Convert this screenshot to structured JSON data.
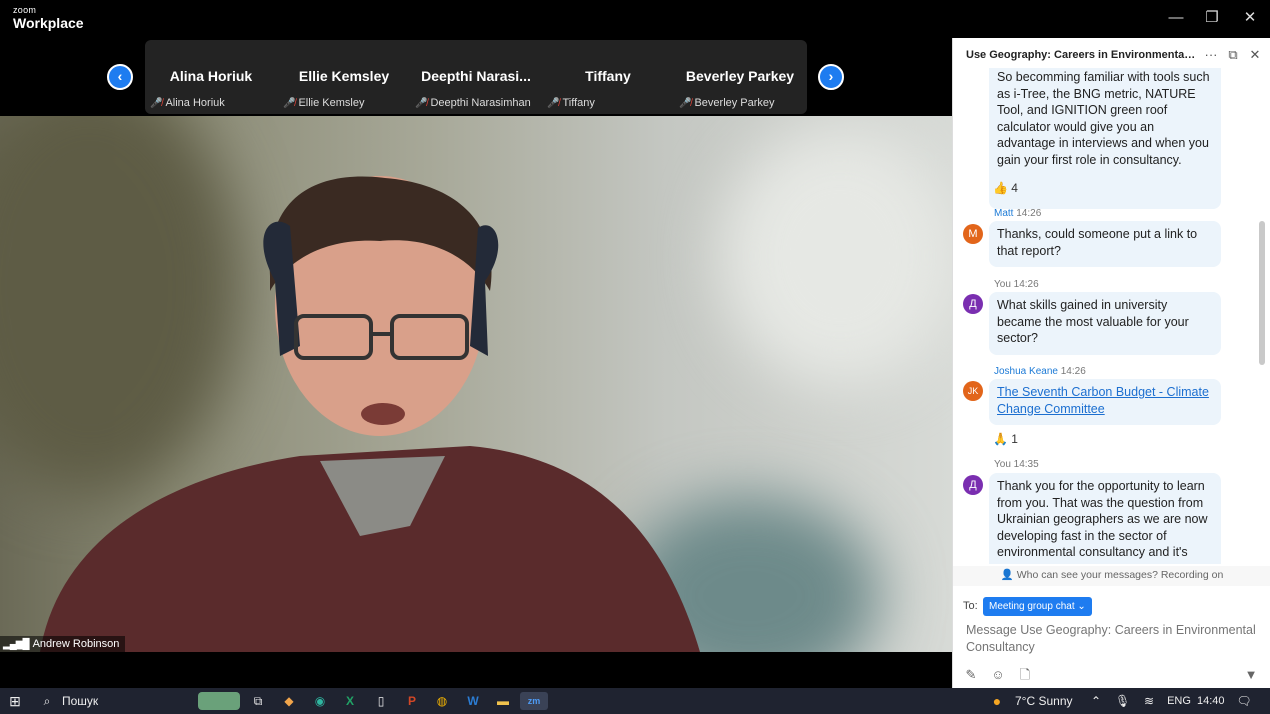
{
  "app": {
    "brand_small": "zoom",
    "brand_big": "Workplace"
  },
  "window_controls": {
    "minimize": "—",
    "restore": "❐",
    "close": "✕"
  },
  "participant_nav": {
    "prev": "‹",
    "next": "›"
  },
  "participants": [
    {
      "tile_name": "Alina Horiuk",
      "label": "Alina Horiuk"
    },
    {
      "tile_name": "Ellie Kemsley",
      "label": "Ellie Kemsley"
    },
    {
      "tile_name": "Deepthi  Narasi...",
      "label": "Deepthi Narasimhan"
    },
    {
      "tile_name": "Tiffany",
      "label": "Tiffany"
    },
    {
      "tile_name": "Beverley Parkey",
      "label": "Beverley Parkey"
    }
  ],
  "speaker": {
    "name": "Andrew Robinson",
    "signal_icon": "signal-bars-icon"
  },
  "chat": {
    "title": "Use Geography: Careers in Environmental C...",
    "header_icons": {
      "more": "···",
      "popout": "⧉",
      "close": "✕"
    },
    "messages": [
      {
        "text": "So becomming familiar with tools such as i-Tree, the BNG metric, NATURE Tool, and IGNITION green roof calculator would give you an advantage in interviews and when you gain your first role in consultancy.",
        "reaction": "👍 4"
      },
      {
        "sender": "Matt",
        "time": "14:26",
        "avatar": "M",
        "avatar_color": "#e2651a",
        "text": "Thanks, could someone put a link to that report?"
      },
      {
        "sender": "You",
        "time": "14:26",
        "avatar": "Д",
        "avatar_color": "#7a2eb0",
        "text": "What skills gained in university became the most valuable for your sector?"
      },
      {
        "sender": "Joshua Keane",
        "time": "14:26",
        "avatar": "JK",
        "avatar_color": "#e2651a",
        "text": "The Seventh Carbon Budget - Climate Change Committee",
        "reaction": "🙏 1"
      },
      {
        "sender": "You",
        "time": "14:35",
        "avatar": "Д",
        "avatar_color": "#7a2eb0",
        "text": "Thank you  for the opportunity to learn from you. That was the question from Ukrainian geographers as we are now  developing fast in the sector of environmental consultancy and it's"
      }
    ],
    "visibility_notice": "Who can see your messages? Recording on",
    "to_label": "To:",
    "recipient": "Meeting group chat",
    "input_placeholder": "Message Use Geography: Careers in Environmental Consultancy"
  },
  "taskbar": {
    "search_label": "Пошук",
    "weather": "7°C  Sunny",
    "language": "ENG",
    "time": "14:40",
    "notification_count": "1"
  }
}
